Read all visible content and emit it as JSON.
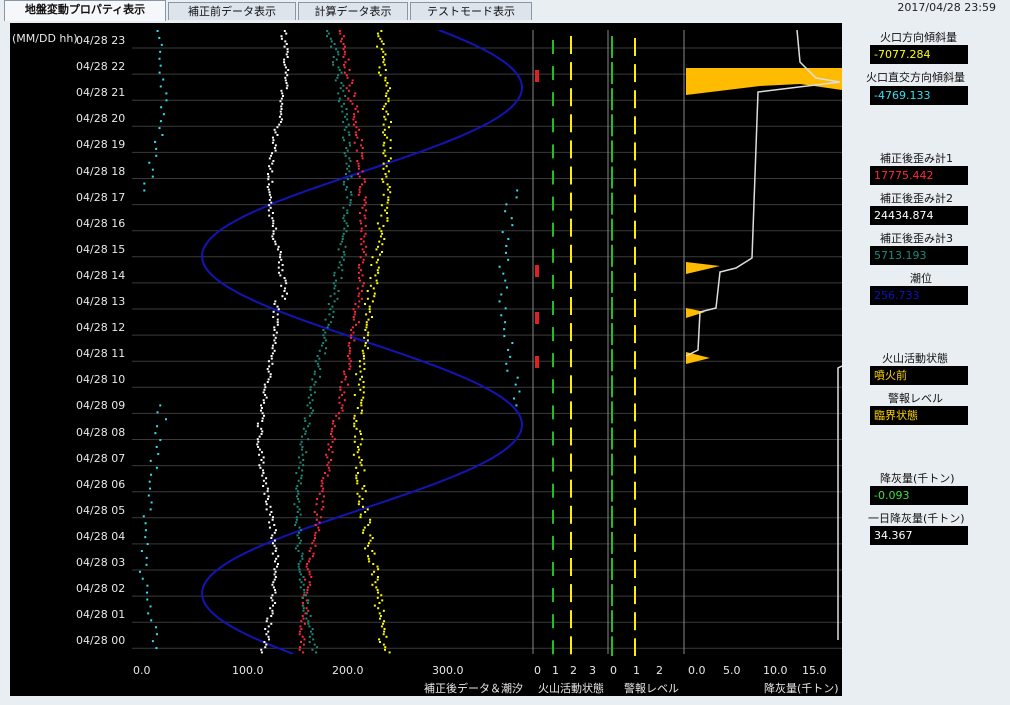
{
  "tabs": [
    {
      "label": "地盤変動プロパティ表示"
    },
    {
      "label": "補正前データ表示"
    },
    {
      "label": "計算データ表示"
    },
    {
      "label": "テストモード表示"
    }
  ],
  "datetime": "2017/04/28 23:59",
  "y_axis_unit": "(MM/DD hh)",
  "y_labels": [
    "04/28 23",
    "04/28 22",
    "04/28 21",
    "04/28 20",
    "04/28 19",
    "04/28 18",
    "04/28 17",
    "04/28 16",
    "04/28 15",
    "04/28 14",
    "04/28 13",
    "04/28 12",
    "04/28 11",
    "04/28 10",
    "04/28 09",
    "04/28 08",
    "04/28 07",
    "04/28 06",
    "04/28 05",
    "04/28 04",
    "04/28 03",
    "04/28 02",
    "04/28 01",
    "04/28 00"
  ],
  "panels": {
    "main": {
      "title": "補正後データ＆潮汐",
      "ticks": [
        "0.0",
        "100.0",
        "200.0",
        "300.0"
      ]
    },
    "volcano": {
      "title": "火山活動状態",
      "ticks": [
        "0",
        "1",
        "2",
        "3"
      ]
    },
    "alert": {
      "title": "警報レベル",
      "ticks": [
        "0",
        "1",
        "2"
      ]
    },
    "ash": {
      "title": "降灰量(千トン)",
      "ticks": [
        "0.0",
        "5.0",
        "10.0",
        "15.0"
      ]
    }
  },
  "side": {
    "tilt_crater": {
      "label": "火口方向傾斜量",
      "value": "-7077.284",
      "color": "#ffff00"
    },
    "tilt_cross": {
      "label": "火口直交方向傾斜量",
      "value": "-4769.133",
      "color": "#33e0f0"
    },
    "strain1": {
      "label": "補正後歪み計1",
      "value": "17775.442",
      "color": "#ff2a3a"
    },
    "strain2": {
      "label": "補正後歪み計2",
      "value": "24434.874",
      "color": "#ffffff"
    },
    "strain3": {
      "label": "補正後歪み計3",
      "value": "5713.193",
      "color": "#1a8a7a"
    },
    "tide": {
      "label": "潮位",
      "value": "256.733",
      "color": "#1010c0"
    },
    "volcano_state": {
      "label": "火山活動状態",
      "value": "噴火前",
      "color": "#ffd400"
    },
    "alert_level": {
      "label": "警報レベル",
      "value": "臨界状態",
      "color": "#ffd400"
    },
    "ash_fall": {
      "label": "降灰量(千トン)",
      "value": "-0.093",
      "color": "#40e040"
    },
    "ash_daily": {
      "label": "一日降灰量(千トン)",
      "value": "34.367",
      "color": "#ffffff"
    }
  }
}
